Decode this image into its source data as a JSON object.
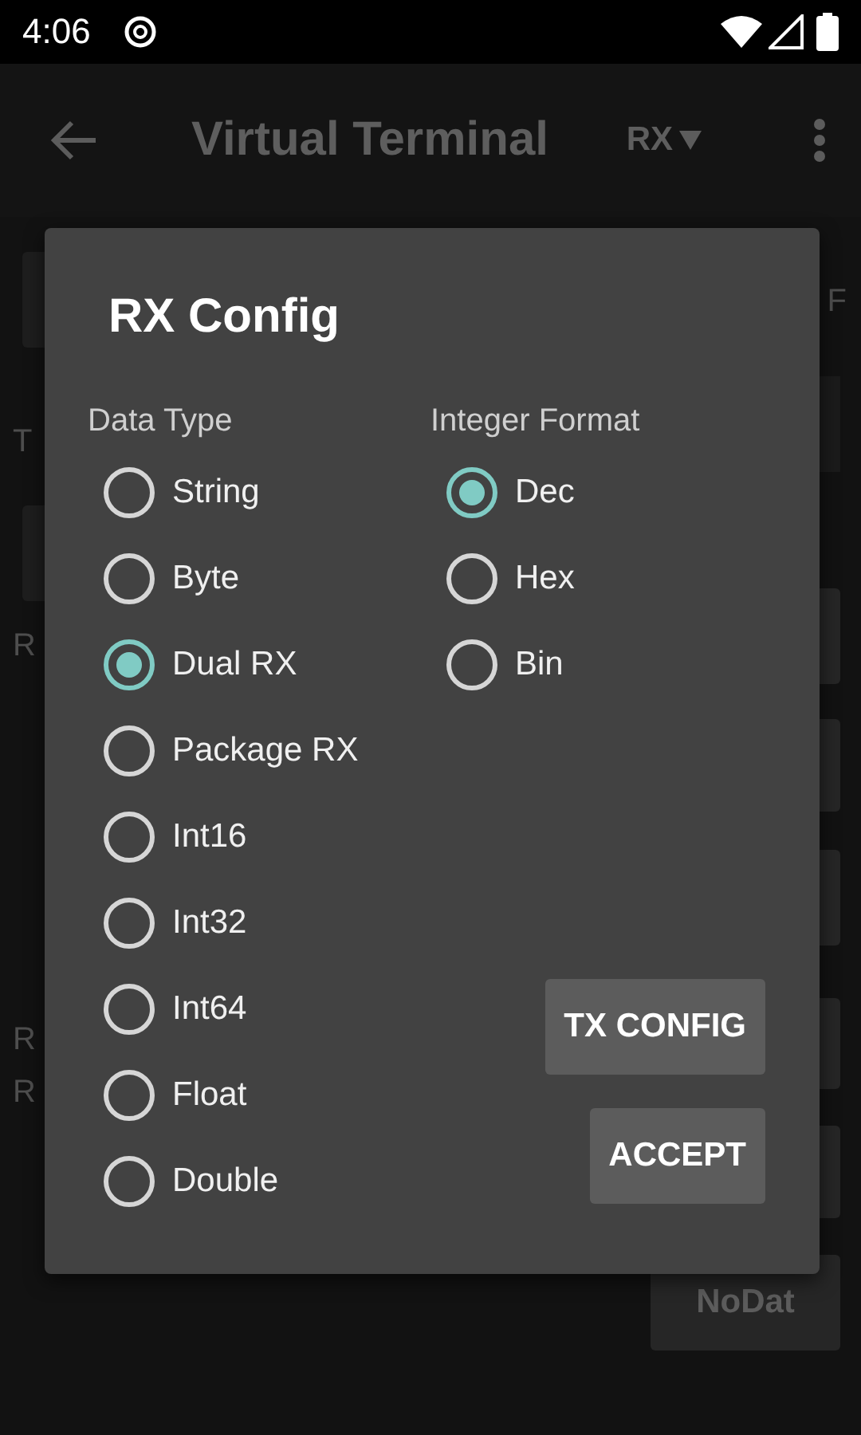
{
  "status_bar": {
    "time": "4:06"
  },
  "app_bar": {
    "title": "Virtual Terminal",
    "mode": "RX"
  },
  "background": {
    "corner_label": "F",
    "side_labels": [
      "T",
      "R",
      "R",
      "R"
    ],
    "bottom_button": "NoDat"
  },
  "dialog": {
    "title": "RX Config",
    "data_type": {
      "label": "Data Type",
      "options": [
        {
          "label": "String",
          "selected": false
        },
        {
          "label": "Byte",
          "selected": false
        },
        {
          "label": "Dual RX",
          "selected": true
        },
        {
          "label": "Package RX",
          "selected": false
        },
        {
          "label": "Int16",
          "selected": false
        },
        {
          "label": "Int32",
          "selected": false
        },
        {
          "label": "Int64",
          "selected": false
        },
        {
          "label": "Float",
          "selected": false
        },
        {
          "label": "Double",
          "selected": false
        }
      ]
    },
    "integer_format": {
      "label": "Integer Format",
      "options": [
        {
          "label": "Dec",
          "selected": true
        },
        {
          "label": "Hex",
          "selected": false
        },
        {
          "label": "Bin",
          "selected": false
        }
      ]
    },
    "buttons": [
      "TX CONFIG",
      "ACCEPT"
    ]
  }
}
